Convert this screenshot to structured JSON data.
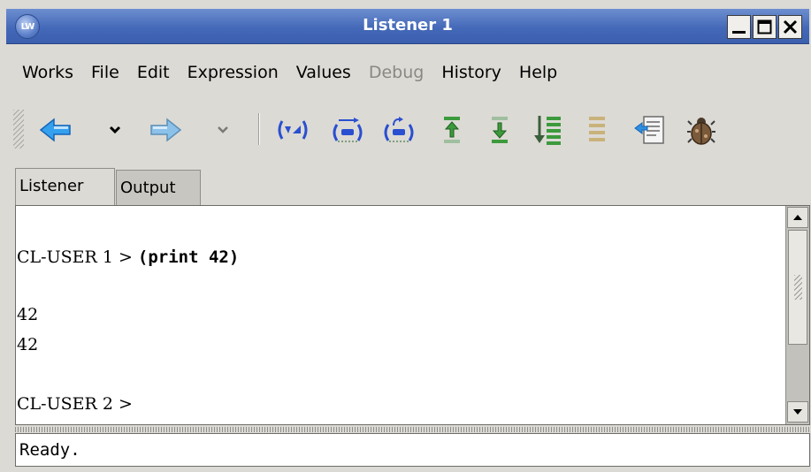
{
  "window": {
    "title": "Listener 1",
    "app_icon_text": "LW"
  },
  "menu": {
    "items": [
      {
        "label": "Works",
        "enabled": true
      },
      {
        "label": "File",
        "enabled": true
      },
      {
        "label": "Edit",
        "enabled": true
      },
      {
        "label": "Expression",
        "enabled": true
      },
      {
        "label": "Values",
        "enabled": true
      },
      {
        "label": "Debug",
        "enabled": false
      },
      {
        "label": "History",
        "enabled": true
      },
      {
        "label": "Help",
        "enabled": true
      }
    ]
  },
  "toolbar": {
    "buttons": [
      {
        "icon": "back-arrow-icon"
      },
      {
        "icon": "back-history-dropdown-icon"
      },
      {
        "icon": "forward-arrow-icon"
      },
      {
        "icon": "forward-history-dropdown-icon"
      },
      {
        "icon": "evaluate-icon"
      },
      {
        "icon": "step-over-icon"
      },
      {
        "icon": "step-return-icon"
      },
      {
        "icon": "previous-history-icon"
      },
      {
        "icon": "next-history-icon"
      },
      {
        "icon": "history-list-icon"
      },
      {
        "icon": "collapse-history-icon"
      },
      {
        "icon": "copy-output-icon"
      },
      {
        "icon": "debug-bug-icon"
      }
    ]
  },
  "tabs": [
    {
      "label": "Listener",
      "active": true
    },
    {
      "label": "Output",
      "active": false
    }
  ],
  "listener": {
    "prompt1": "CL-USER 1 > ",
    "input1": "(print 42)",
    "output1": "42",
    "output2": "42",
    "prompt2": "CL-USER 2 >"
  },
  "status": {
    "text": "Ready."
  },
  "colors": {
    "titlebar": "#4469b8",
    "window_bg": "#dcdad5",
    "arrow_blue": "#2f8ee0",
    "command_blue": "#2a4fd0",
    "history_green": "#3c9a3c"
  }
}
